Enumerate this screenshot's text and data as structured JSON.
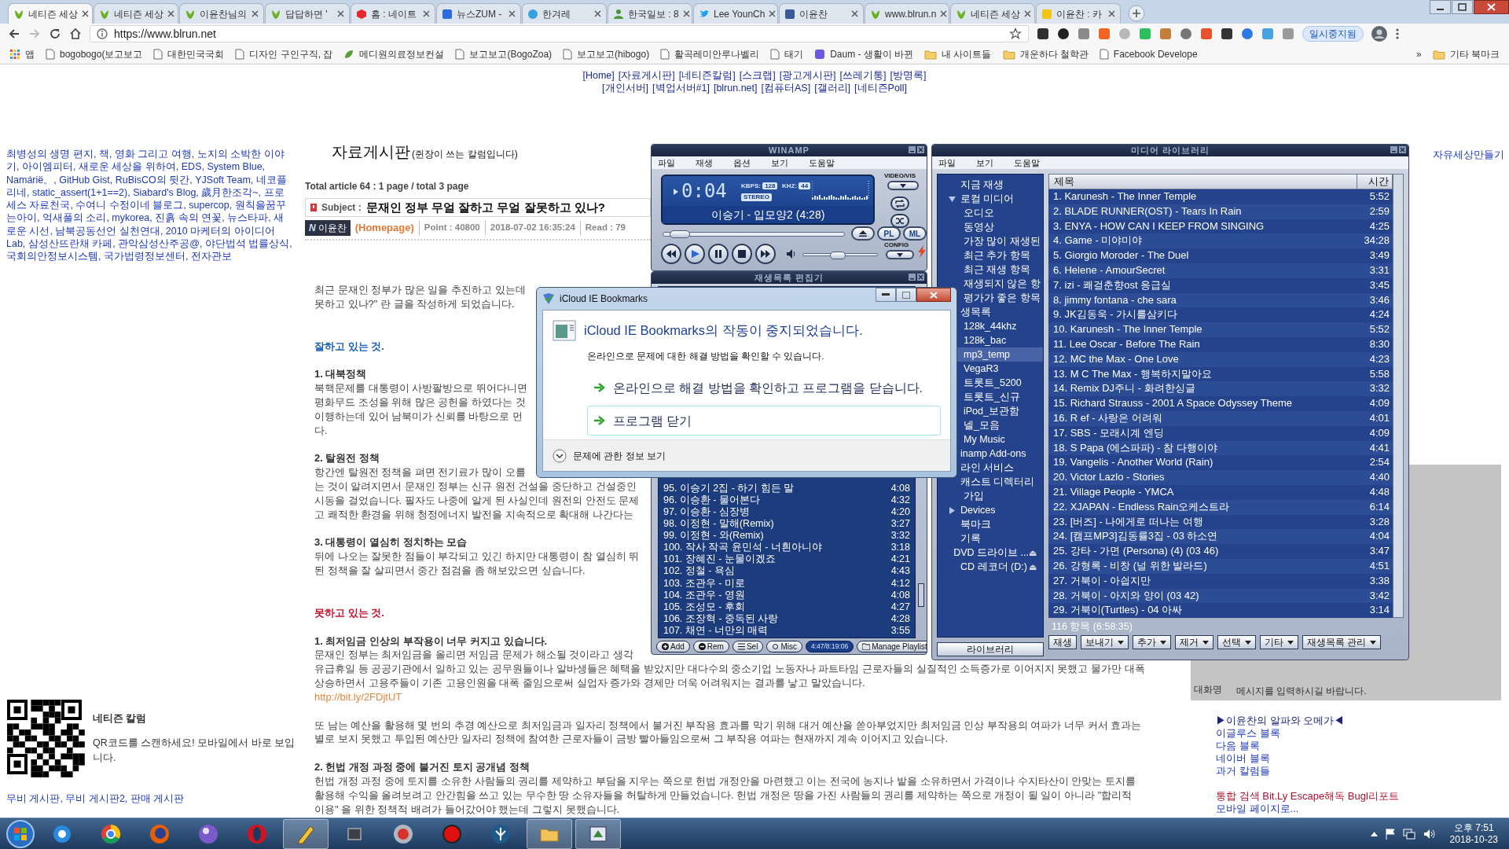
{
  "browser": {
    "tabs": [
      {
        "title": "네티즌 세상",
        "selected": true
      },
      {
        "title": "네티즌 세상",
        "selected": false
      },
      {
        "title": "이윤찬님의",
        "selected": false
      },
      {
        "title": "답답하면 '",
        "selected": false
      },
      {
        "title": "홈 : 네이트",
        "selected": false
      },
      {
        "title": "뉴스ZUM -",
        "selected": false
      },
      {
        "title": "한겨레",
        "selected": false
      },
      {
        "title": "한국일보 : 8",
        "selected": false
      },
      {
        "title": "Lee YounCh",
        "selected": false
      },
      {
        "title": "이윤찬",
        "selected": false
      },
      {
        "title": "www.blrun.n",
        "selected": false
      },
      {
        "title": "네티즌 세상",
        "selected": false
      },
      {
        "title": "이윤찬 : 카",
        "selected": false
      }
    ],
    "url": "https://www.blrun.net",
    "paused_label": "일시중지됨",
    "bookmarks": [
      {
        "kind": "apps",
        "label": "앱"
      },
      {
        "kind": "page",
        "label": "bogobogo(보고보고"
      },
      {
        "kind": "page",
        "label": "대한민국국회"
      },
      {
        "kind": "page",
        "label": "디자인 구인구직, 잡"
      },
      {
        "kind": "leaf",
        "label": "메디원의료정보컨설"
      },
      {
        "kind": "page",
        "label": "보고보고(BogoZoa)"
      },
      {
        "kind": "page",
        "label": "보고보고(hibogo)"
      },
      {
        "kind": "page",
        "label": "활곡레미안루나벨리"
      },
      {
        "kind": "page",
        "label": "태기"
      },
      {
        "kind": "daum",
        "label": "Daum - 생활이 바뀐"
      },
      {
        "kind": "folder",
        "label": "내 사이트들"
      },
      {
        "kind": "folder",
        "label": "개운하다 철학관"
      },
      {
        "kind": "page",
        "label": "Facebook Develope"
      }
    ],
    "overflow": "»",
    "other_bookmarks": "기타 북마크"
  },
  "page": {
    "nav_rows": [
      [
        "[Home]",
        "[자료게시판]",
        "[네티즌칼럼]",
        "[스크랩]",
        "[광고게시판]",
        "[쓰레기통]",
        "[방명록]"
      ],
      [
        "[개인서버]",
        "[벽업서버#1]",
        "[blrun.net]",
        "[컴퓨터AS]",
        "[갤러리]",
        "[네티즌Poll]"
      ]
    ],
    "sidebar": {
      "links_text": "최병성의 생명 편지, 책, 영화 그리고 여행, 노지의 소박한 이야기, 아이엠피터, 새로운 세상을 위하여, EDS, System Blue, Namárië。, GitHub Gist, RuBisCO의 뒷간, YJSoft Team, 네코플리네, static_assert(1+1==2), Siabard's Blog, 歲月한조각~, 프로세스 자료천국, 수여니 수정이네 블로그, supercop, 원칙을꿈꾸는아이, 억새풀의 소리, mykorea, 진흙 속의 연꽃, 뉴스타파, 새로운 시선, 남북공동선언 실천연대, 2010 마케터의 아이디어 Lab, 삼성산뜨란채 카페, 관악삼성산주공@, 야단법석 법률상식, 국회의안정보시스템, 국가법령정보센터, 전자관보",
      "qr_title": "네티즌 칼럼",
      "qr_text": "QR코드를 스캔하세요! 모바일에서 바로 보입니다.",
      "footer_links": "무비 게시판, 무비 게시판2, 판매 게시판"
    },
    "board": {
      "title": "자료게시판",
      "subtitle": "(쥔장이 쓰는 칼럼입니다)",
      "total": "Total article 64 :  1 page / total 3 page",
      "subject_label": "Subject :",
      "subject": "문재인 정부 무얼 잘하고 무얼 잘못하고 있나?",
      "author_badge": "N",
      "author": "이윤찬",
      "homepage": "(Homepage)",
      "point": "Point : 40800",
      "date": "2018-07-02 16:35:24",
      "read": "Read : 79"
    },
    "article": [
      {
        "kind": "text",
        "lines": [
          "최근 문재인 정부가 많은 일을 추진하고 있는데",
          "못하고 있나?\" 란 글을 작성하게 되었습니다."
        ]
      },
      {
        "kind": "heading",
        "color": "#1a5fb4",
        "lines": [
          "잘하고 있는 것."
        ]
      },
      {
        "kind": "subheading",
        "lines": [
          "1. 대북정책"
        ]
      },
      {
        "kind": "text",
        "lines": [
          "북핵문제를 대통령이 사방팔방으로 뛰어다니면",
          "평화무드 조성을 위해 많은 공헌을 하였다는 것",
          "이행하는데 있어 남북미가 신뢰를 바탕으로 먼",
          "다."
        ]
      },
      {
        "kind": "subheading",
        "lines": [
          "2. 탈원전 정책"
        ]
      },
      {
        "kind": "text",
        "lines": [
          "항간엔 탈원전 정책을 펴면 전기료가 많이 오를",
          "는 것이 알려지면서 문재인 정부는 신규 원전 건설을 중단하고 건설중인",
          "시동을 걸었습니다. 필자도 나중에 알게 된 사실인데 원전의 안전도 문제",
          "고 쾌적한 환경을 위해 청정에너지 발전을 지속적으로 확대해 나간다는"
        ]
      },
      {
        "kind": "subheading",
        "lines": [
          "3. 대통령이 열심히 정치하는 모습"
        ]
      },
      {
        "kind": "text",
        "lines": [
          "뒤에 나오는 잘못한 점들이 부각되고 있긴 하지만 대통령이 참 열심히 뛰",
          "된 정책을 잘 살피면서 중간 점검을 좀 해보았으면 싶습니다."
        ]
      },
      {
        "kind": "heading",
        "color": "#c8102e",
        "lines": [
          "못하고 있는 것."
        ]
      },
      {
        "kind": "subheading",
        "lines": [
          "1. 최저임금 인상의 부작용이 너무 커지고 있습니다."
        ]
      },
      {
        "kind": "text",
        "lines": [
          "문재인 정부는 최저임금을 올리면 저임금 문제가 해소될 것이라고 생각",
          "유급휴일 등 공공기관에서 일하고 있는 공무원들이나 알바생들은 혜택을 받았지만 대다수의 중소기업 노동자나 파트타임 근로자들의 실질적인 소득증가로 이어지지 못했고 물가만 대폭",
          "상승하면서 고용주들이 기존 고용인원을 대폭 줄임으로써 실업자 증가와 경제만 더욱 어려워지는 결과를 낳고 말았습니다."
        ]
      },
      {
        "kind": "link",
        "lines": [
          "http://bit.ly/2FDjtUT"
        ]
      },
      {
        "kind": "text",
        "lines": [
          "또 남는 예산을 활용해 몇 번의 추경 예산으로 최저임금과 일자리 정책에서 불거진 부작용 효과를 막기 위해 대거 예산을 쏟아부었지만 최저임금 인상 부작용의 여파가 너무 커서 효과는",
          "별로 보지 못했고 투입된 예산만 일자리 정책에 참여한 근로자들이 금방 빨아들임으로써 그 부작용 여파는 현재까지 계속 이어지고 있습니다."
        ]
      },
      {
        "kind": "subheading",
        "lines": [
          "2. 헌법 개정 과정 중에 불거진 토지 공개념 정책"
        ]
      },
      {
        "kind": "text",
        "lines": [
          "헌법 개정 과정 중에 토지를 소유한 사람들의 권리를 제약하고 부담을 지우는 쪽으로 헌법 개정안을 마련했고 이는 전국에 농지나 밭을 소유하면서 가격이나 수지타산이 안맞는 토지를",
          "활용해 수익을 올려보려고 안간힘을 쓰고 있는 무수한 땅 소유자들을 허탈하게 만들었습니다. 헌법 개정은 땅을 가진 사람들의 권리를 제약하는 쪽으로 개정이 될 일이 아니라 \"합리적",
          "이용\" 을 위한 정책적 배려가 들어갔어야 했는데 그렇지 못했습니다."
        ]
      }
    ],
    "right": {
      "top_link": "자유세상만들기",
      "chat_nick": "대화명",
      "chat_placeholder": "메시지를 입력하시길 바랍니다.",
      "links": [
        {
          "text": "▶이윤찬의 알파와 오메가◀",
          "kind": "highlight"
        },
        {
          "text": "이글루스 블록",
          "kind": "link"
        },
        {
          "text": "다음 블록",
          "kind": "link"
        },
        {
          "text": "네이버 블록",
          "kind": "link"
        },
        {
          "text": "과거 칼럼들",
          "kind": "link"
        },
        {
          "text": "통합 검색 Bit.Ly Escape해독 Bugl리포트",
          "kind": "alert"
        },
        {
          "text": "모바일 페이지로...",
          "kind": "link"
        }
      ]
    }
  },
  "winamp": {
    "title": "WINAMP",
    "menu": [
      "파일",
      "재생",
      "옵션",
      "보기",
      "도움말"
    ],
    "time": "0:04",
    "kbps_label": "KBPS:",
    "kbps": "128",
    "khz_label": "KHZ:",
    "khz": "44",
    "stereo": "STEREO",
    "song": "이승기 - 입모양2 (4:28)",
    "vis_label": "VIDEO/VIS",
    "config_label": "CONFIG",
    "pl": "PL",
    "ml": "ML",
    "seek": {
      "level": 0.04
    },
    "volume": {
      "level": 0.45
    }
  },
  "playlist": {
    "title": "재생목록 편집기",
    "rows": [
      {
        "title": "95. 이승기 2집 - 하기 힘든 말",
        "time": "4:08"
      },
      {
        "title": "96. 이승환 - 물어본다",
        "time": "4:32"
      },
      {
        "title": "97. 이승환 - 심장병",
        "time": "4:20"
      },
      {
        "title": "98. 이정현 - 말해(Remix)",
        "time": "3:27"
      },
      {
        "title": "99. 이정현 - 와(Remix)",
        "time": "3:32"
      },
      {
        "title": "100. 작사 작곡  윤민석 - 너흰아니야",
        "time": "3:18"
      },
      {
        "title": "101. 장혜진 - 눈물이겠죠",
        "time": "4:21"
      },
      {
        "title": "102. 정철 - 욕심",
        "time": "4:43"
      },
      {
        "title": "103. 조관우 - 미로",
        "time": "4:12"
      },
      {
        "title": "104. 조관우 - 영원",
        "time": "4:08"
      },
      {
        "title": "105. 조성모 - 후회",
        "time": "4:27"
      },
      {
        "title": "106. 조장혁 - 중독된 사랑",
        "time": "4:28"
      },
      {
        "title": "107. 채연 - 너만의 매력",
        "time": "3:55"
      }
    ],
    "buttons": [
      "Add",
      "Rem",
      "Sel",
      "Misc"
    ],
    "total_time": "4:47/8:19:06",
    "manage": "Manage Playlist"
  },
  "library": {
    "title": "미디어 라이브러리",
    "menu": [
      "파일",
      "보기",
      "도움말"
    ],
    "tree": [
      {
        "label": "지금 재생",
        "selected": false
      },
      {
        "label": "로컬 미디어",
        "selected": false,
        "expanded": true,
        "children": [
          {
            "label": "오디오",
            "selected": false
          },
          {
            "label": "동영상",
            "selected": false
          },
          {
            "label": "가장 많이 재생된",
            "selected": false
          },
          {
            "label": "최근 추가 항목",
            "selected": false
          },
          {
            "label": "최근 재생 항목",
            "selected": false
          },
          {
            "label": "재생되지 않은 항",
            "selected": false
          },
          {
            "label": "평가가 좋은 항목",
            "selected": false
          }
        ]
      },
      {
        "label": "생목록",
        "selected": false,
        "children": [
          {
            "label": "128k_44khz",
            "selected": false
          },
          {
            "label": "128k_bac",
            "selected": false
          },
          {
            "label": "mp3_temp",
            "selected": true
          },
          {
            "label": "VegaR3",
            "selected": false
          },
          {
            "label": "트롯트_5200",
            "selected": false
          },
          {
            "label": "트롯트_신규",
            "selected": false
          },
          {
            "label": "iPod_보관함",
            "selected": false
          },
          {
            "label": "넬_모음",
            "selected": false
          },
          {
            "label": "My Music",
            "selected": false
          }
        ]
      },
      {
        "label": "inamp Add-ons",
        "selected": false
      },
      {
        "label": "라인 서비스",
        "selected": false
      },
      {
        "label": "캐스트 디렉터리",
        "selected": false,
        "children": [
          {
            "label": "가입",
            "selected": false
          }
        ]
      },
      {
        "label": "Devices",
        "selected": false,
        "expanded": false
      },
      {
        "label": "북마크",
        "selected": false
      },
      {
        "label": "기록",
        "selected": false
      },
      {
        "label": "DVD 드라이브 ...",
        "selected": false,
        "eject": "⏏"
      },
      {
        "label": "CD 레코더 (D:)",
        "selected": false,
        "eject": "⏏"
      }
    ],
    "library_button": "라이브러리",
    "columns": [
      "제목",
      "시간"
    ],
    "rows": [
      {
        "title": "1. Karunesh - The Inner Temple",
        "time": "5:52"
      },
      {
        "title": "2. BLADE RUNNER(OST) - Tears In Rain",
        "time": "2:59"
      },
      {
        "title": "3. ENYA - HOW CAN I KEEP FROM SINGING",
        "time": "4:25"
      },
      {
        "title": "4. Game - 미야미야",
        "time": "34:28"
      },
      {
        "title": "5. Giorgio Moroder - The Duel",
        "time": "3:49"
      },
      {
        "title": "6. Helene - AmourSecret",
        "time": "3:31"
      },
      {
        "title": "7. izi - 쾌걸춘향ost 응급실",
        "time": "3:45"
      },
      {
        "title": "8. jimmy fontana - che sara",
        "time": "3:46"
      },
      {
        "title": "9. JK김동욱 - 가시를삼키다",
        "time": "4:24"
      },
      {
        "title": "10. Karunesh - The Inner Temple",
        "time": "5:52"
      },
      {
        "title": "11. Lee Oscar - Before The Rain",
        "time": "8:30"
      },
      {
        "title": "12. MC the Max - One Love",
        "time": "4:23"
      },
      {
        "title": "13. M C The Max - 행복하지말아요",
        "time": "5:58"
      },
      {
        "title": "14. Remix DJ주니 - 화려한싱글",
        "time": "3:32"
      },
      {
        "title": "15. Richard Strauss - 2001  A Space Odyssey Theme",
        "time": "4:09"
      },
      {
        "title": "16. R ef - 사랑은 어려워",
        "time": "4:01"
      },
      {
        "title": "17. SBS - 모래시계 엔딩",
        "time": "4:09"
      },
      {
        "title": "18. S Papa (에스파파) - 참 다행이야",
        "time": "4:41"
      },
      {
        "title": "19. Vangelis  - Another World (Rain)",
        "time": "2:54"
      },
      {
        "title": "20. Victor Lazlo - Stories",
        "time": "4:40"
      },
      {
        "title": "21. Village People - YMCA",
        "time": "4:48"
      },
      {
        "title": "22. XJAPAN - Endless Rain오케스트라",
        "time": "6:14"
      },
      {
        "title": "23. [버즈] - 나에게로 떠나는 여행",
        "time": "3:28"
      },
      {
        "title": "24. [캠프MP3]김동률3집 - 03 하소연",
        "time": "4:04"
      },
      {
        "title": "25. 강타 - 가면 (Persona) (4) (03 46)",
        "time": "3:47"
      },
      {
        "title": "26. 강형록 - 비창 (널 위한 발라드)",
        "time": "4:51"
      },
      {
        "title": "27. 거북이 - 아싑지만",
        "time": "3:38"
      },
      {
        "title": "28. 거북이 - 아지와 양이 (03 42)",
        "time": "3:42"
      },
      {
        "title": "29. 거북이(Turtles) - 04 아싸",
        "time": "3:14"
      }
    ],
    "status": "116 항목 (6:58:35)",
    "buttons": [
      {
        "label": "재생",
        "dropdown": false
      },
      {
        "label": "보내기",
        "dropdown": true
      },
      {
        "label": "추가",
        "dropdown": true
      },
      {
        "label": "제거",
        "dropdown": true
      },
      {
        "label": "선택",
        "dropdown": true
      },
      {
        "label": "기타",
        "dropdown": true
      },
      {
        "label": "재생목록 관리",
        "dropdown": true
      }
    ]
  },
  "dialog": {
    "title": "iCloud IE Bookmarks",
    "heading": "iCloud IE Bookmarks의 작동이 중지되었습니다.",
    "message": "온라인으로 문제에 대한 해결 방법을 확인할 수 있습니다.",
    "options": [
      {
        "label": "온라인으로 해결 방법을 확인하고 프로그램을 닫습니다.",
        "selected": false
      },
      {
        "label": "프로그램 닫기",
        "selected": true
      }
    ],
    "details": "문제에 관한 정보 보기"
  },
  "taskbar": {
    "apps": [
      {
        "active": false
      },
      {
        "active": false
      },
      {
        "active": false
      },
      {
        "active": false
      },
      {
        "active": false
      },
      {
        "active": true
      },
      {
        "active": false
      },
      {
        "active": false
      },
      {
        "active": false
      },
      {
        "active": false
      },
      {
        "active": true
      },
      {
        "active": true
      }
    ],
    "time": "오후 7:51",
    "date": "2018-10-23"
  }
}
